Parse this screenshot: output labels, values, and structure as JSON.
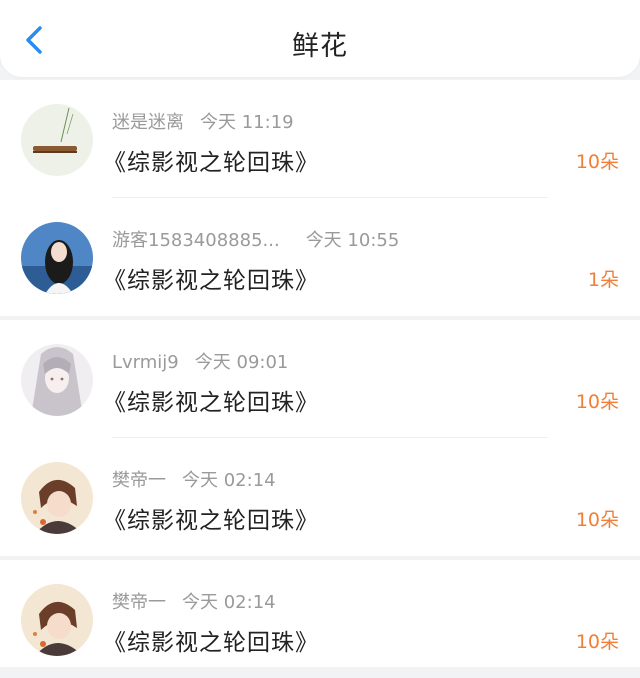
{
  "header": {
    "title": "鲜花",
    "back_icon": "chevron-left-icon"
  },
  "colors": {
    "accent": "#2a8cf0",
    "count": "#f07f3a",
    "meta": "#9a9a9a",
    "text": "#222222"
  },
  "items": [
    {
      "name": "迷是迷离",
      "time": "今天 11:19",
      "book": "《综影视之轮回珠》",
      "count": "10朵"
    },
    {
      "name": "游客1583408885...",
      "time": "今天 10:55",
      "book": "《综影视之轮回珠》",
      "count": "1朵"
    },
    {
      "name": "Lvrmij9",
      "time": "今天 09:01",
      "book": "《综影视之轮回珠》",
      "count": "10朵"
    },
    {
      "name": "樊帝一",
      "time": "今天 02:14",
      "book": "《综影视之轮回珠》",
      "count": "10朵"
    },
    {
      "name": "樊帝一",
      "time": "今天 02:14",
      "book": "《综影视之轮回珠》",
      "count": "10朵"
    }
  ]
}
